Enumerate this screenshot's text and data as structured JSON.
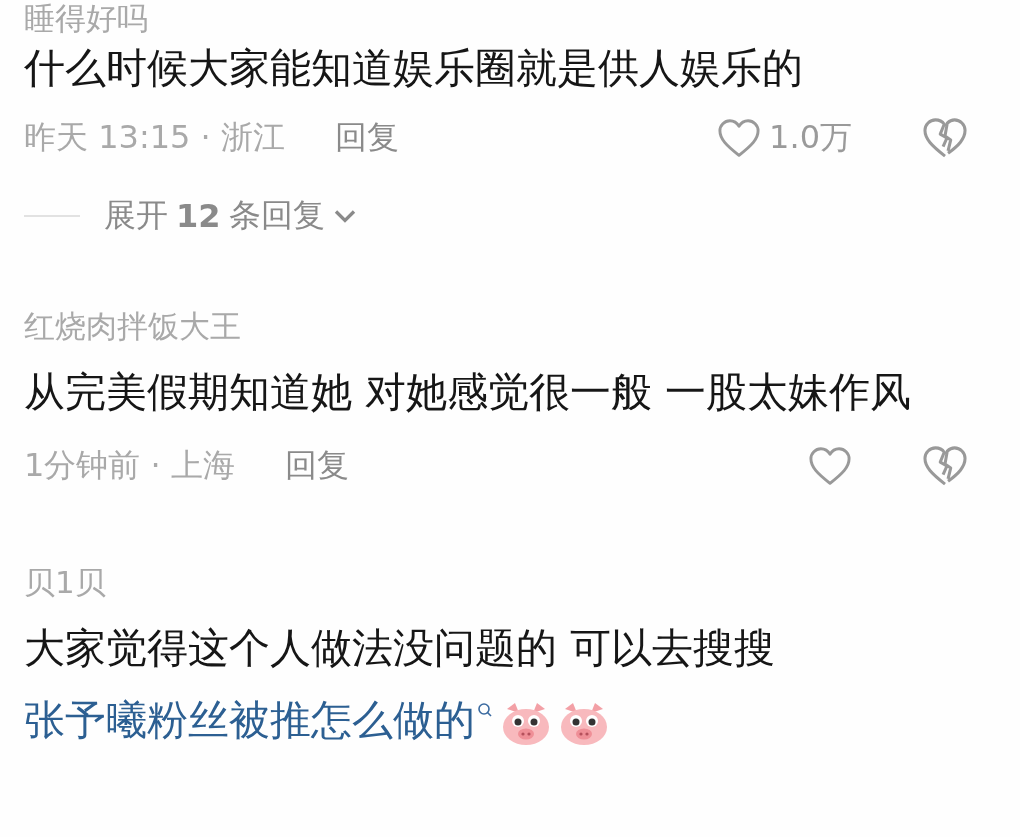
{
  "comments": [
    {
      "username": "睡得好吗",
      "text": "什么时候大家能知道娱乐圈就是供人娱乐的",
      "time_location": "昨天 13:15 · 浙江",
      "reply_label": "回复",
      "likes": "1.0万",
      "expand": "展开 **12** 条回复"
    },
    {
      "username": "红烧肉拌饭大王",
      "text": "从完美假期知道她 对她感觉很一般 一股太妹作风",
      "time_location": "1分钟前 · 上海",
      "reply_label": "回复"
    },
    {
      "username": "贝1贝",
      "text": "大家觉得这个人做法没问题的 可以去搜搜",
      "link": "张予曦粉丝被推怎么做的",
      "emojis": [
        {
          "kind": "pig"
        },
        {
          "kind": "pig"
        }
      ]
    }
  ]
}
